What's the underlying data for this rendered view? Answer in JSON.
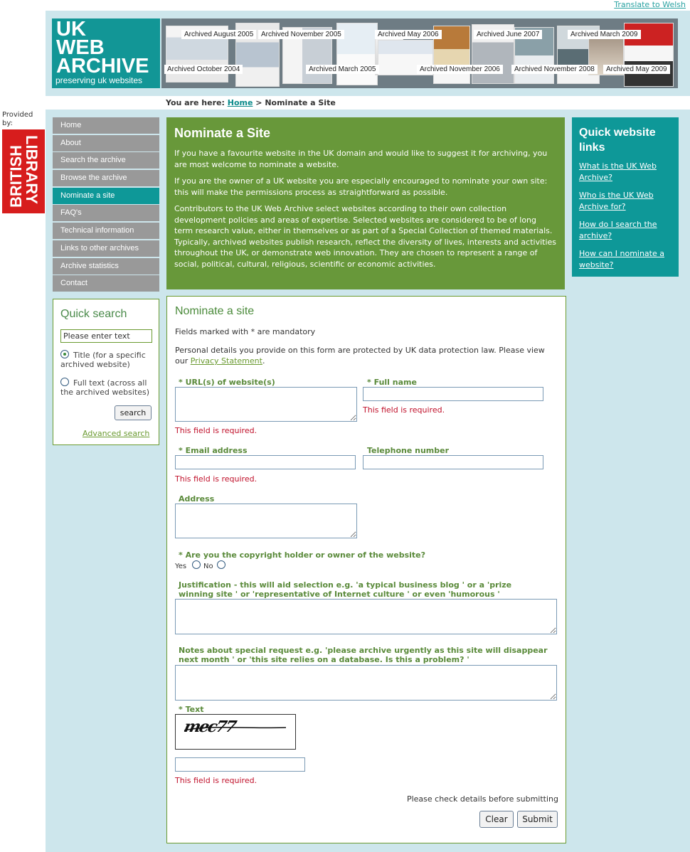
{
  "header": {
    "translate_link": "Translate to Welsh",
    "logo_line1": "UK",
    "logo_line2": "WEB",
    "logo_line3": "ARCHIVE",
    "logo_tagline": "preserving uk websites",
    "banner_labels": [
      "Archived August 2005",
      "Archived November 2005",
      "Archived May 2006",
      "Archived June 2007",
      "Archived March 2009",
      "Archived October 2004",
      "Archived March 2005",
      "Archived November 2006",
      "Archived November 2008",
      "Archived May 2009"
    ]
  },
  "breadcrumb": {
    "prefix": "You are here:",
    "home": "Home",
    "separator": ">",
    "current": "Nominate a Site"
  },
  "provider": {
    "provided_by": "Provided by:",
    "library_line1": "BRITISH",
    "library_line2": "LIBRARY"
  },
  "nav": {
    "items": [
      "Home",
      "About",
      "Search the archive",
      "Browse the archive",
      "Nominate a site",
      "FAQ's",
      "Technical information",
      "Links to other archives",
      "Archive statistics",
      "Contact"
    ],
    "active_index": 4
  },
  "quick_search": {
    "heading": "Quick search",
    "input_value": "Please enter text",
    "option_title": "Title (for a specific archived website)",
    "option_fulltext": "Full text (across all the archived websites)",
    "selected_option": "Title",
    "search_button": "search",
    "advanced_link": "Advanced search"
  },
  "intro": {
    "heading": "Nominate a Site",
    "p1": "If you have a favourite website in the UK domain and would like to suggest it for archiving, you are most welcome to nominate a website.",
    "p2": "If you are the owner of a UK website you are especially encouraged to nominate your own site: this will make the permissions process as straightforward as possible.",
    "p3": "Contributors to the UK Web Archive select websites according to their own collection development policies and areas of expertise. Selected websites are considered to be of long term research value, either in themselves or as part of a Special Collection of themed materials. Typically, archived websites publish research, reflect the diversity of lives, interests and activities throughout the UK, or demonstrate web innovation. They are chosen to represent a range of social, political, cultural, religious, scientific or economic activities."
  },
  "quick_links": {
    "heading": "Quick website links",
    "links": [
      "What is the UK Web Archive?",
      "Who is the UK Web Archive for?",
      "How do I search the archive?",
      "How can I nominate a website?"
    ]
  },
  "form": {
    "title": "Nominate a site",
    "mandatory_note": "Fields marked with * are mandatory",
    "privacy_note_before": "Personal details you provide on this form are protected by UK data protection law. Please view our",
    "privacy_link": "Privacy Statement",
    "privacy_note_after": ".",
    "required_marker": "*",
    "url_label": "URL(s) of website(s)",
    "fullname_label": "Full name",
    "email_label": "Email address",
    "telephone_label": "Telephone number",
    "address_label": "Address",
    "copyright_label": "Are you the copyright holder or owner of the website?",
    "yes_label": "Yes",
    "no_label": "No",
    "justification_label": "Justification - this will aid selection e.g. 'a typical business blog ' or a 'prize winning site ' or 'representative of Internet culture ' or even 'humorous '",
    "notes_label": "Notes about special request e.g. 'please archive urgently as this site will disappear next month ' or 'this site relies on a database. Is this a problem? '",
    "captcha_label": "Text",
    "captcha_text": "mec77",
    "error_required": "This field is required.",
    "check_note": "Please check details before submitting",
    "clear_button": "Clear",
    "submit_button": "Submit"
  }
}
